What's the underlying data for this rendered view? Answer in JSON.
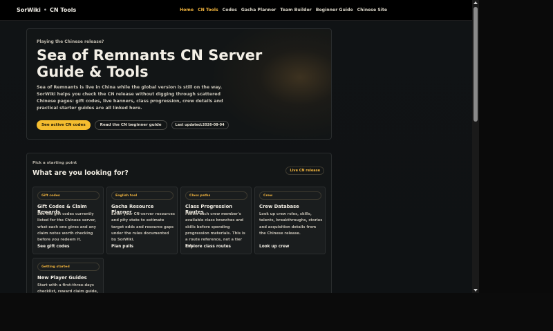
{
  "topbar": {
    "brand": "SorWiki",
    "brand_separator": "•",
    "brand_sub": "CN Tools",
    "nav": [
      "Home",
      "CN Tools",
      "Codes",
      "Gacha Planner",
      "Team Builder",
      "Beginner Guide",
      "Chinese Site"
    ],
    "active_color": "#f0b33d"
  },
  "hero": {
    "eyebrow": "Playing the Chinese release?",
    "title": "Sea of Remnants CN Server Guide & Tools",
    "description": "Sea of Remnants is live in China while the global version is still on the way. SorWiki helps you check the CN release without digging through scattered Chinese pages: gift codes, live banners, class progression, crew details and practical starter guides are all linked here.",
    "primary_button": "See active CN codes",
    "secondary_button": "Read the CN beginner guide",
    "updated_label": "Last updated:2026-08-04"
  },
  "section": {
    "eyebrow": "Pick a starting point",
    "title": "What are you looking for?",
    "badge": "Live CN release",
    "cards": [
      {
        "tag": "Gift codes",
        "title": "Gift Codes & Claim Rewards",
        "desc": "See the gift codes currently listed for the Chinese server, what each one gives and any claim notes worth checking before you redeem it.",
        "link": "See gift codes"
      },
      {
        "tag": "English tool",
        "title": "Gacha Resource Planner",
        "desc": "Enter your CN-server resources and pity state to estimate target odds and resource gaps under the rules documented by SorWiki.",
        "link": "Plan pulls"
      },
      {
        "tag": "Class paths",
        "title": "Class Progression Routes",
        "desc": "Follow each crew member's available class branches and skills before spending progression materials. This is a route reference, not a tier list.",
        "link": "Explore class routes"
      },
      {
        "tag": "Crew",
        "title": "Crew Database",
        "desc": "Look up crew roles, skills, talents, breakthroughs, stories and acquisition details from the Chinese release.",
        "link": "Look up crew"
      },
      {
        "tag": "Getting started",
        "title": "New Player Guides",
        "desc": "Start with a first-three-days checklist, reward claim guide, six-",
        "link": ""
      }
    ]
  }
}
